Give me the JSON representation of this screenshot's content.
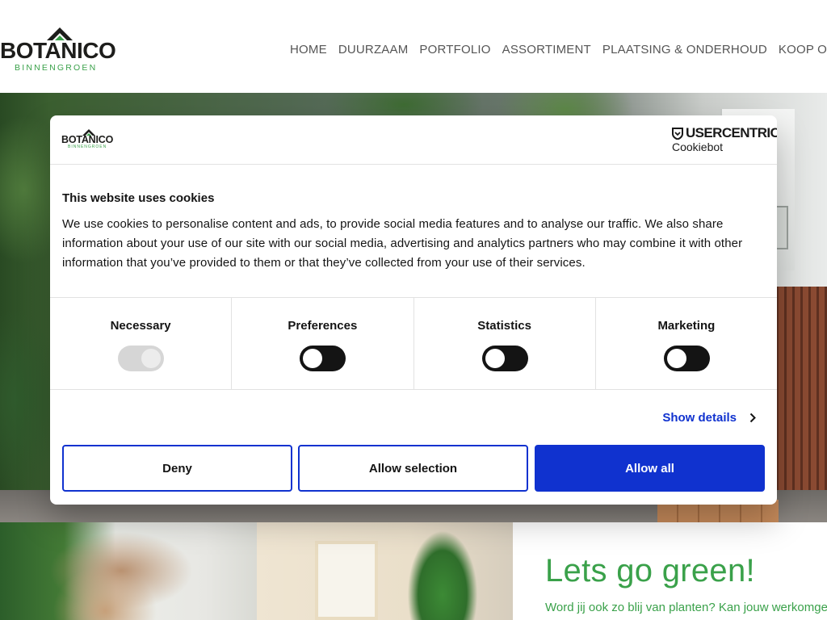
{
  "site": {
    "logo": {
      "word": "BOTANICO",
      "sub": "BINNENGROEN"
    },
    "nav": [
      {
        "label": "HOME"
      },
      {
        "label": "DUURZAAM"
      },
      {
        "label": "PORTFOLIO"
      },
      {
        "label": "ASSORTIMENT"
      },
      {
        "label": "PLAATSING & ONDERHOUD"
      },
      {
        "label": "KOOP OF LEASE"
      }
    ]
  },
  "promo": {
    "title": "Lets go green!",
    "body": "Word jij ook zo blij van planten? Kan jouw werkomgeving"
  },
  "cookie": {
    "logo": {
      "word": "BOTANICO",
      "sub": "BINNENGROEN"
    },
    "brand": {
      "name": "USERCENTRICS",
      "sub": "Cookiebot"
    },
    "title": "This website uses cookies",
    "text": "We use cookies to personalise content and ads, to provide social media features and to analyse our traffic. We also share information about your use of our site with our social media, advertising and analytics partners who may combine it with other information that you’ve provided to them or that they’ve collected from your use of their services.",
    "categories": [
      {
        "label": "Necessary",
        "checked": true,
        "disabled": true
      },
      {
        "label": "Preferences",
        "checked": false,
        "disabled": false
      },
      {
        "label": "Statistics",
        "checked": false,
        "disabled": false
      },
      {
        "label": "Marketing",
        "checked": false,
        "disabled": false
      }
    ],
    "details_label": "Show details",
    "buttons": {
      "deny": "Deny",
      "selection": "Allow selection",
      "all": "Allow all"
    }
  },
  "colors": {
    "brand_green": "#3aa14a",
    "cookie_accent": "#1032cf",
    "text_dark": "#141414"
  }
}
